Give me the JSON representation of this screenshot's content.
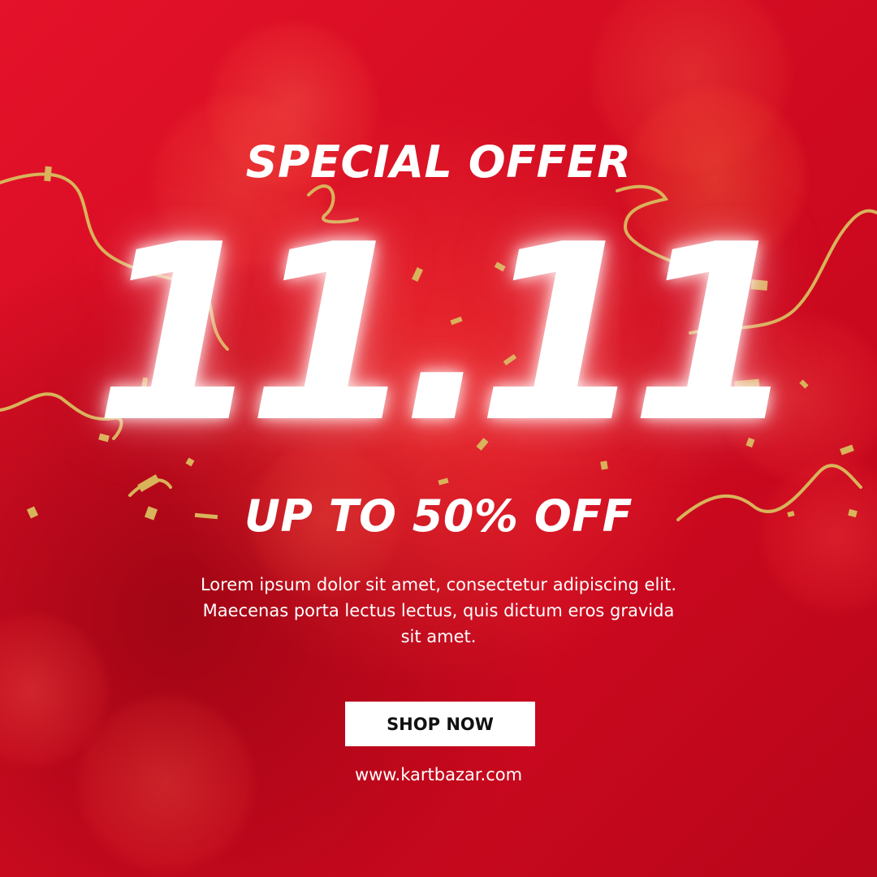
{
  "headline": {
    "top_line": "SPECIAL OFFER",
    "big_date": "11.11",
    "discount": "UP TO 50% OFF"
  },
  "body_text": "Lorem ipsum dolor sit amet, consectetur adipiscing elit. Maecenas porta lectus lectus, quis dictum eros gravida sit amet.",
  "cta": {
    "label": "SHOP NOW"
  },
  "website": "www.kartbazar.com",
  "colors": {
    "background": "#d40c22",
    "text": "#ffffff",
    "button_background": "#ffffff",
    "button_text": "#111111",
    "ribbon_gold": "#d8b45a"
  },
  "decorations": [
    "bokeh-light",
    "gold-ribbon",
    "gold-confetti"
  ]
}
